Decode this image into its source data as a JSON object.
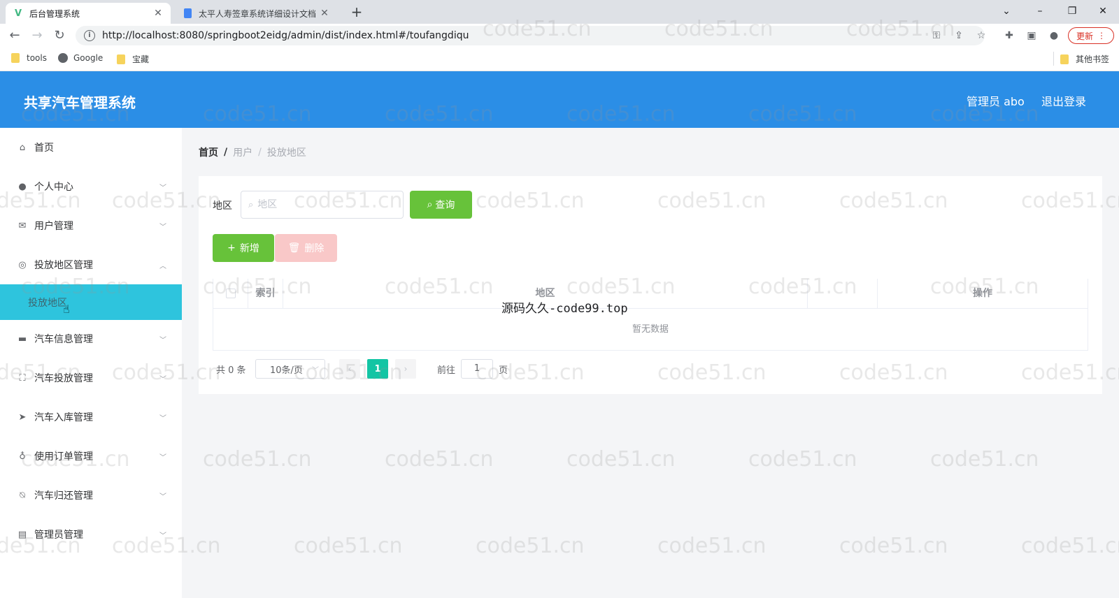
{
  "browser": {
    "tabs": [
      {
        "title": "后台管理系统",
        "favicon": "V",
        "active": true
      },
      {
        "title": "太平人寿签章系统详细设计文档",
        "favicon": "doc",
        "active": false
      }
    ],
    "url": "http://localhost:8080/springboot2eidg/admin/dist/index.html#/toufangdiqu",
    "update_label": "更新",
    "bookmarks": [
      "tools",
      "Google",
      "宝藏"
    ],
    "other_bookmarks": "其他书签"
  },
  "app": {
    "title": "共享汽车管理系统",
    "user_label": "管理员 abo",
    "logout_label": "退出登录"
  },
  "sidebar": {
    "items": [
      {
        "label": "首页",
        "icon": "home-icon"
      },
      {
        "label": "个人中心",
        "icon": "user-icon"
      },
      {
        "label": "用户管理",
        "icon": "mail-icon"
      },
      {
        "label": "投放地区管理",
        "icon": "compass-icon",
        "expanded": true
      },
      {
        "label": "汽车信息管理",
        "icon": "monitor-icon"
      },
      {
        "label": "汽车投放管理",
        "icon": "fullscreen-icon"
      },
      {
        "label": "汽车入库管理",
        "icon": "send-icon"
      },
      {
        "label": "使用订单管理",
        "icon": "microphone-icon"
      },
      {
        "label": "汽车归还管理",
        "icon": "bell-off-icon"
      },
      {
        "label": "管理员管理",
        "icon": "chat-icon"
      }
    ],
    "active_sub": "投放地区"
  },
  "breadcrumb": {
    "home": "首页",
    "level1": "用户",
    "level2": "投放地区"
  },
  "search": {
    "label": "地区",
    "placeholder": "地区",
    "button": "查询"
  },
  "actions": {
    "add": "新增",
    "delete": "删除"
  },
  "table": {
    "columns": [
      "索引",
      "地区",
      "操作"
    ],
    "empty_text": "暂无数据"
  },
  "pagination": {
    "total_text": "共 0 条",
    "page_size": "10条/页",
    "current_page": "1",
    "goto_label": "前往",
    "goto_value": "1",
    "page_suffix": "页"
  },
  "overlay_text": "源码久久-code99.top",
  "watermark": "code51.cn",
  "colors": {
    "header": "#2b8ee6",
    "active_sub": "#2ec4dd",
    "success": "#67c23a",
    "page_active": "#13c5a4"
  }
}
